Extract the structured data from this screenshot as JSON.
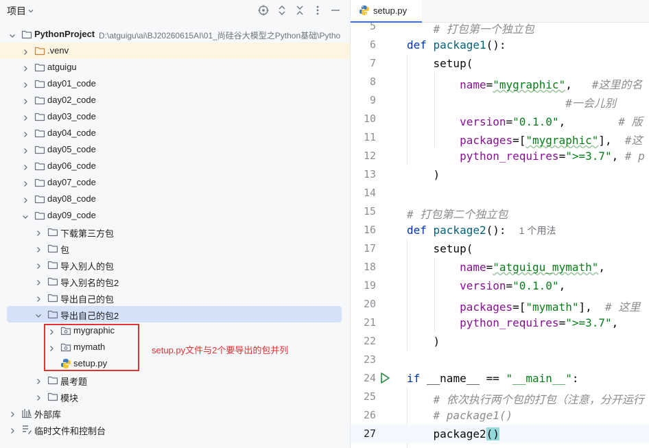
{
  "project_panel": {
    "title": "项目",
    "header_buttons": [
      "crosshair-icon",
      "expand-all-icon",
      "collapse-all-icon",
      "more-icon",
      "minimize-icon"
    ],
    "rows": [
      {
        "label": "PythonProject",
        "path": "D:\\atguigu\\ai\\BJ20260615AI\\01_尚硅谷大模型之Python基础\\Pytho",
        "bold": true,
        "icon": "folder-icon",
        "expanded": true,
        "depth": 0
      },
      {
        "label": ".venv",
        "icon": "folder-icon",
        "expanded": false,
        "depth": 1,
        "excluded": true
      },
      {
        "label": "atguigu",
        "icon": "folder-icon",
        "expanded": false,
        "depth": 1
      },
      {
        "label": "day01_code",
        "icon": "folder-icon",
        "expanded": false,
        "depth": 1
      },
      {
        "label": "day02_code",
        "icon": "folder-icon",
        "expanded": false,
        "depth": 1
      },
      {
        "label": "day03_code",
        "icon": "folder-icon",
        "expanded": false,
        "depth": 1
      },
      {
        "label": "day04_code",
        "icon": "folder-icon",
        "expanded": false,
        "depth": 1
      },
      {
        "label": "day05_code",
        "icon": "folder-icon",
        "expanded": false,
        "depth": 1
      },
      {
        "label": "day06_code",
        "icon": "folder-icon",
        "expanded": false,
        "depth": 1
      },
      {
        "label": "day07_code",
        "icon": "folder-icon",
        "expanded": false,
        "depth": 1
      },
      {
        "label": "day08_code",
        "icon": "folder-icon",
        "expanded": false,
        "depth": 1
      },
      {
        "label": "day09_code",
        "icon": "folder-icon",
        "expanded": true,
        "depth": 1
      },
      {
        "label": "下载第三方包",
        "icon": "folder-icon",
        "expanded": false,
        "depth": 2
      },
      {
        "label": "包",
        "icon": "folder-icon",
        "expanded": false,
        "depth": 2
      },
      {
        "label": "导入别人的包",
        "icon": "folder-icon",
        "expanded": false,
        "depth": 2
      },
      {
        "label": "导入别名的包2",
        "icon": "folder-icon",
        "expanded": false,
        "depth": 2
      },
      {
        "label": "导出自己的包",
        "icon": "folder-icon",
        "expanded": false,
        "depth": 2
      },
      {
        "label": "导出自己的包2",
        "icon": "folder-icon",
        "expanded": true,
        "depth": 2,
        "selected": true
      },
      {
        "label": "mygraphic",
        "icon": "package-icon",
        "expanded": false,
        "depth": 3
      },
      {
        "label": "mymath",
        "icon": "package-icon",
        "expanded": false,
        "depth": 3
      },
      {
        "label": "setup.py",
        "icon": "python-file-icon",
        "leaf": true,
        "depth": 3
      },
      {
        "label": "晨考题",
        "icon": "folder-icon",
        "expanded": false,
        "depth": 2
      },
      {
        "label": "模块",
        "icon": "folder-icon",
        "expanded": false,
        "depth": 2
      },
      {
        "label": "外部库",
        "icon": "library-icon",
        "expanded": false,
        "depth": 0
      },
      {
        "label": "临时文件和控制台",
        "icon": "scratches-icon",
        "expanded": false,
        "depth": 0
      }
    ],
    "callout": "setup.py文件与2个要导出的包并列"
  },
  "editor": {
    "tab": {
      "label": "setup.py",
      "icon": "python-file-icon"
    },
    "current_line": "27",
    "lines": [
      {
        "n": "5",
        "tokens": [
          [
            "    ",
            ""
          ],
          [
            "# 打包第一个独立包",
            "cm"
          ]
        ]
      },
      {
        "n": "6",
        "tokens": [
          [
            "def ",
            "kw"
          ],
          [
            "package1",
            "fn"
          ],
          [
            "():",
            ""
          ]
        ]
      },
      {
        "n": "7",
        "tokens": [
          [
            "    setup(",
            ""
          ]
        ]
      },
      {
        "n": "8",
        "tokens": [
          [
            "        ",
            ""
          ],
          [
            "name",
            "par"
          ],
          [
            "=",
            ""
          ],
          [
            "\"mygraphic\"",
            "str wavy"
          ],
          [
            ",   ",
            ""
          ],
          [
            "#这里的名",
            "cm"
          ]
        ]
      },
      {
        "n": "9",
        "tokens": [
          [
            "                        ",
            ""
          ],
          [
            "#一会儿别",
            "cm"
          ]
        ]
      },
      {
        "n": "10",
        "tokens": [
          [
            "        ",
            ""
          ],
          [
            "version",
            "par"
          ],
          [
            "=",
            ""
          ],
          [
            "\"0.1.0\"",
            "str"
          ],
          [
            ",        ",
            ""
          ],
          [
            "# 版",
            "cm"
          ]
        ]
      },
      {
        "n": "11",
        "tokens": [
          [
            "        ",
            ""
          ],
          [
            "packages",
            "par"
          ],
          [
            "=[",
            ""
          ],
          [
            "\"mygraphic\"",
            "str wavy"
          ],
          [
            "],  ",
            ""
          ],
          [
            "#这",
            "cm"
          ]
        ]
      },
      {
        "n": "12",
        "tokens": [
          [
            "        ",
            ""
          ],
          [
            "python_requires",
            "par"
          ],
          [
            "=",
            ""
          ],
          [
            "\">=3.7\"",
            "str"
          ],
          [
            ", ",
            ""
          ],
          [
            "# p",
            "cm"
          ]
        ]
      },
      {
        "n": "13",
        "tokens": [
          [
            "    )",
            ""
          ]
        ]
      },
      {
        "n": "14",
        "tokens": []
      },
      {
        "n": "15",
        "tokens": [
          [
            "# 打包第二个独立包",
            "cm"
          ]
        ]
      },
      {
        "n": "16",
        "tokens": [
          [
            "def ",
            "kw"
          ],
          [
            "package2",
            "fn"
          ],
          [
            "():  ",
            ""
          ],
          [
            "1 个用法",
            "hint"
          ]
        ]
      },
      {
        "n": "17",
        "tokens": [
          [
            "    setup(",
            ""
          ]
        ]
      },
      {
        "n": "18",
        "tokens": [
          [
            "        ",
            ""
          ],
          [
            "name",
            "par"
          ],
          [
            "=",
            ""
          ],
          [
            "\"atguigu_mymath\"",
            "str wavy"
          ],
          [
            ",",
            ""
          ]
        ]
      },
      {
        "n": "19",
        "tokens": [
          [
            "        ",
            ""
          ],
          [
            "version",
            "par"
          ],
          [
            "=",
            ""
          ],
          [
            "\"0.1.0\"",
            "str"
          ],
          [
            ",",
            ""
          ]
        ]
      },
      {
        "n": "20",
        "tokens": [
          [
            "        ",
            ""
          ],
          [
            "packages",
            "par"
          ],
          [
            "=[",
            ""
          ],
          [
            "\"mymath\"",
            "str"
          ],
          [
            "],  ",
            ""
          ],
          [
            "# 这里",
            "cm"
          ]
        ]
      },
      {
        "n": "21",
        "tokens": [
          [
            "        ",
            ""
          ],
          [
            "python_requires",
            "par"
          ],
          [
            "=",
            ""
          ],
          [
            "\">=3.7\"",
            "str"
          ],
          [
            ",",
            ""
          ]
        ]
      },
      {
        "n": "22",
        "tokens": [
          [
            "    )",
            ""
          ]
        ]
      },
      {
        "n": "23",
        "tokens": []
      },
      {
        "n": "24",
        "tokens": [
          [
            "if ",
            "kw"
          ],
          [
            "__name__ == ",
            ""
          ],
          [
            "\"__main__\"",
            "str"
          ],
          [
            ":",
            ""
          ]
        ],
        "run": true
      },
      {
        "n": "25",
        "tokens": [
          [
            "    ",
            ""
          ],
          [
            "# 依次执行两个包的打包（注意，分开运行",
            "cm"
          ]
        ]
      },
      {
        "n": "26",
        "tokens": [
          [
            "    ",
            ""
          ],
          [
            "# package1()",
            "cm"
          ]
        ]
      },
      {
        "n": "27",
        "tokens": [
          [
            "    package2",
            ""
          ],
          [
            "()",
            "paren-hl"
          ]
        ]
      }
    ]
  },
  "colors": {
    "selection": "#d5e1f7",
    "excluded_row": "#fdf4e2",
    "callout": "#e03131",
    "keyword": "#0033b3",
    "string": "#067d17",
    "param": "#871094",
    "comment": "#8c8c8c",
    "function": "#00627a"
  }
}
